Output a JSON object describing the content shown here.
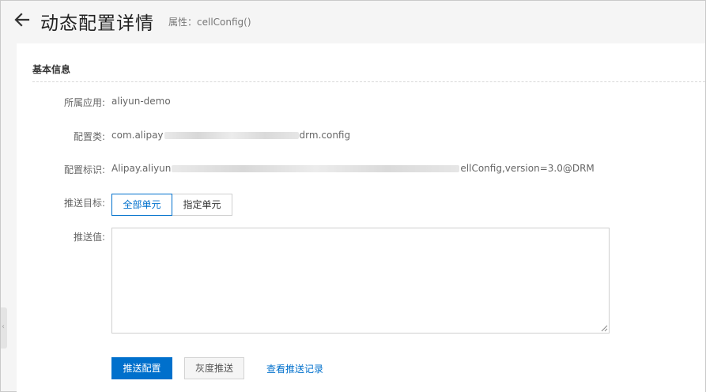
{
  "header": {
    "title": "动态配置详情",
    "subtitle": "属性：cellConfig()"
  },
  "section": {
    "title": "基本信息"
  },
  "fields": {
    "app_label": "所属应用:",
    "app_value": "aliyun-demo",
    "class_label": "配置类:",
    "class_prefix": "com.alipay",
    "class_suffix": "drm.config",
    "id_label": "配置标识:",
    "id_prefix": "Alipay.aliyun",
    "id_suffix": "ellConfig,version=3.0@DRM",
    "target_label": "推送目标:",
    "push_value_label": "推送值:"
  },
  "target_options": {
    "all_units": "全部单元",
    "specific_units": "指定单元",
    "selected": "全部单元"
  },
  "push_value": {
    "value": ""
  },
  "actions": {
    "push_config": "推送配置",
    "gray_push": "灰度推送",
    "view_history": "查看推送记录"
  },
  "side_handle": {
    "glyph": "‹"
  },
  "colors": {
    "accent": "#0070cc",
    "background": "#f5f5f5",
    "card": "#ffffff"
  },
  "icons": {
    "back": "arrow-left-icon",
    "resize": "resize-grip-icon"
  }
}
